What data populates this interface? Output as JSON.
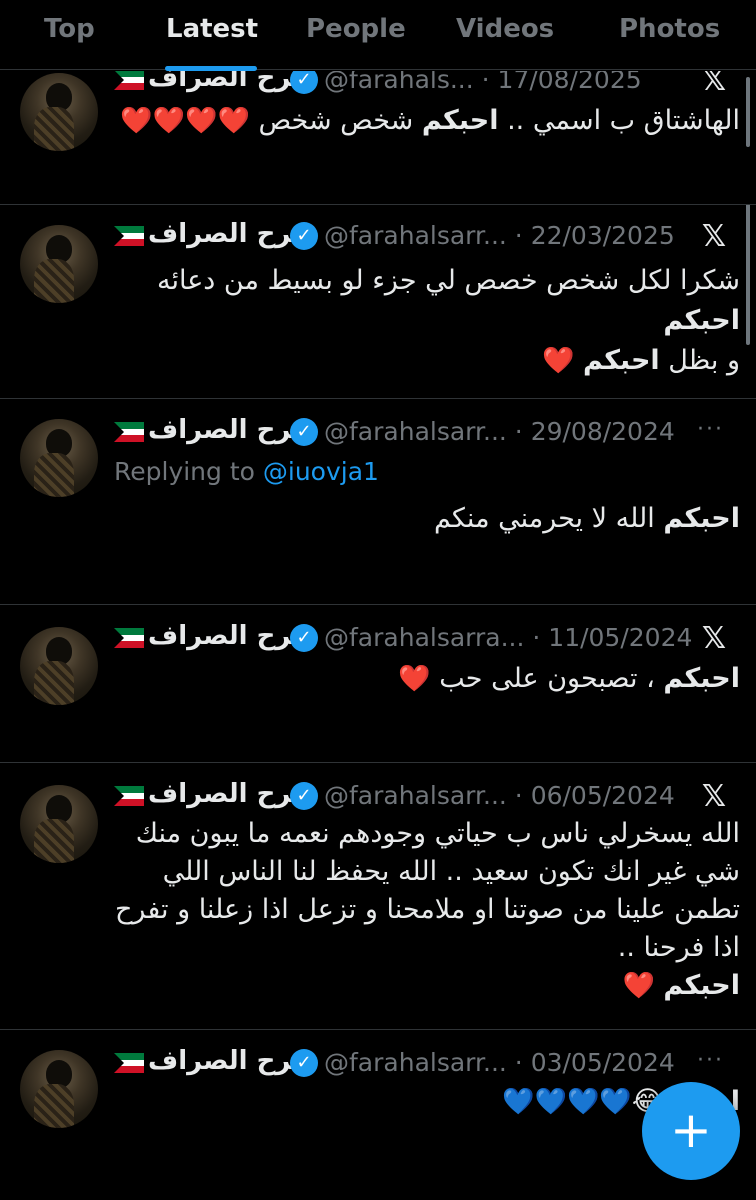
{
  "tabs": [
    {
      "label": "Top"
    },
    {
      "label": "Latest"
    },
    {
      "label": "People"
    },
    {
      "label": "Videos"
    },
    {
      "label": "Photos"
    }
  ],
  "active_tab": "Latest",
  "colors": {
    "accent": "#1d9bf0",
    "background": "#000000",
    "muted": "#71767b",
    "heart": "#f91880"
  },
  "author_name": "فرح الصراف",
  "flag": "kuwait-flag",
  "tweets": [
    {
      "handle": "@farahals...",
      "date": "17/08/2025",
      "corner": "𝕏",
      "text_plain_1": "الهاشتاق ب اسمي .. ",
      "text_bold": "احبكم",
      "text_plain_2": " شخص شخص ",
      "emoji": "❤️❤️❤️❤️"
    },
    {
      "handle": "@farahalsarr...",
      "date": "22/03/2025",
      "corner": "𝕏",
      "text_plain_1": "شكرا لكل شخص خصص لي جزء لو بسيط من دعائه ",
      "text_bold": "احبكم",
      "text_plain_2": " و بظل ",
      "text_bold_2": "احبكم",
      "emoji": " ❤️"
    },
    {
      "handle": "@farahalsarr...",
      "date": "29/08/2024",
      "corner": "···",
      "reply_prefix": "Replying to ",
      "reply_to": "@iuovja1",
      "text_bold": "احبكم",
      "text_plain_1": " الله لا يحرمني منكم"
    },
    {
      "handle": "@farahalsarra...",
      "date": "11/05/2024",
      "corner": "𝕏",
      "text_bold": "احبكم",
      "text_plain_1": " ، تصبحون على حب ",
      "emoji": "❤️"
    },
    {
      "handle": "@farahalsarr...",
      "date": "06/05/2024",
      "corner": "𝕏",
      "text_plain_1": "الله يسخرلي ناس ب حياتي وجودهم نعمه ما يبون منك شي غير انك تكون سعيد .. الله يحفظ لنا الناس اللي تطمن علينا من صوتنا او ملامحنا و تزعل اذا زعلنا و تفرح اذا فرحنا ..",
      "text_bold": "احبكم",
      "emoji": " ❤️"
    },
    {
      "handle": "@farahalsarr...",
      "date": "03/05/2024",
      "corner": "···",
      "text_bold": "احبكم",
      "emoji_laugh": "😂",
      "emoji": "💙💙💙💙"
    }
  ],
  "fab_label": "+"
}
